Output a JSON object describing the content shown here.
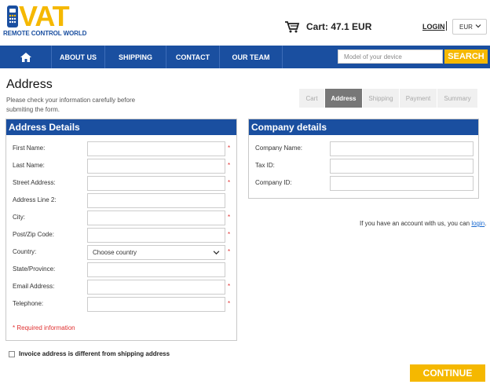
{
  "logo": {
    "brand": "VAT",
    "tagline": "REMOTE CONTROL WORLD"
  },
  "header": {
    "cart_label": "Cart: 47.1 EUR",
    "login_label": "LOGIN",
    "currency": "EUR"
  },
  "nav": {
    "items": [
      "ABOUT US",
      "SHIPPING",
      "CONTACT",
      "OUR TEAM"
    ],
    "search_placeholder": "Model of your device",
    "search_button": "SEARCH"
  },
  "page": {
    "title": "Address",
    "subtitle": "Please check your information carefully before submiting the form."
  },
  "steps": [
    {
      "label": "Cart",
      "active": false
    },
    {
      "label": "Address",
      "active": true
    },
    {
      "label": "Shipping",
      "active": false
    },
    {
      "label": "Payment",
      "active": false
    },
    {
      "label": "Summary",
      "active": false
    }
  ],
  "address": {
    "heading": "Address Details",
    "fields": [
      {
        "label": "First Name:",
        "value": "",
        "required": "*"
      },
      {
        "label": "Last Name:",
        "value": "",
        "required": "*"
      },
      {
        "label": "Street Address:",
        "value": "",
        "required": "*"
      },
      {
        "label": "Address Line 2:",
        "value": "",
        "required": ""
      },
      {
        "label": "City:",
        "value": "",
        "required": "*"
      },
      {
        "label": "Post/Zip Code:",
        "value": "",
        "required": "*"
      },
      {
        "label": "Country:",
        "value": "Choose country",
        "required": "*"
      },
      {
        "label": "State/Province:",
        "value": "",
        "required": ""
      },
      {
        "label": "Email Address:",
        "value": "",
        "required": "*"
      },
      {
        "label": "Telephone:",
        "value": "",
        "required": "*"
      }
    ],
    "required_note": "* Required information"
  },
  "company": {
    "heading": "Company details",
    "fields": [
      {
        "label": "Company Name:",
        "value": ""
      },
      {
        "label": "Tax ID:",
        "value": ""
      },
      {
        "label": "Company ID:",
        "value": ""
      }
    ]
  },
  "account_note": {
    "text": "If you have an account with us, you can ",
    "link": "login",
    "end": "."
  },
  "invoice_label": "Invoice address is different from shipping address",
  "continue_label": "CONTINUE",
  "colors": {
    "brand_blue": "#1a4fa0",
    "accent_yellow": "#f5b800",
    "required_red": "#e03030"
  }
}
